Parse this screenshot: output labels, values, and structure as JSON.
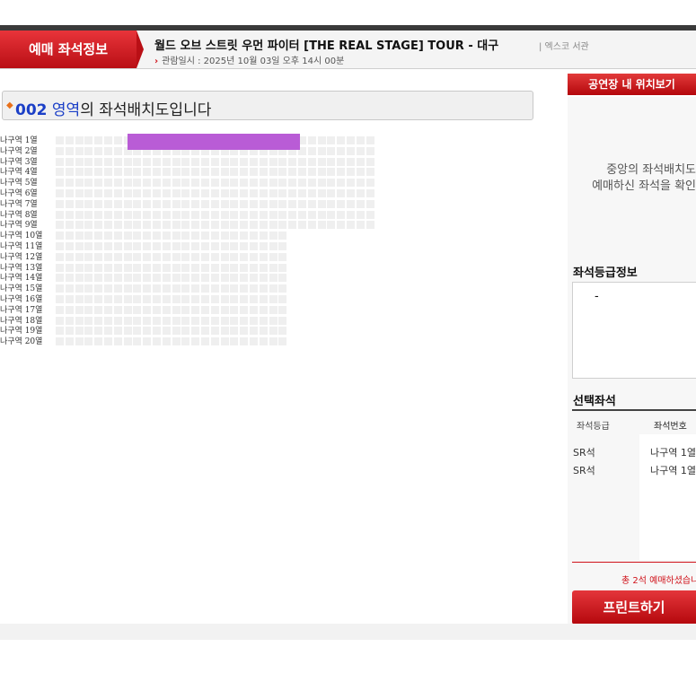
{
  "header": {
    "brand": "예매 좌석정보",
    "show_title": "월드 오브 스트릿 우먼 파이터 [THE REAL STAGE] TOUR - 대구",
    "venue": "| 엑스코 서관",
    "date_line": "관람일시 : 2025년 10월 03일 오후 14시 00분"
  },
  "location_button": "공연장 내 위치보기",
  "zone": {
    "number": "002",
    "name": "영역",
    "suffix": "의 좌석배치도입니다"
  },
  "rows": [
    "나구역 1열",
    "나구역 2열",
    "나구역 3열",
    "나구역 4열",
    "나구역 5열",
    "나구역 6열",
    "나구역 7열",
    "나구역 8열",
    "나구역 9열",
    "나구역 10열",
    "나구역 11열",
    "나구역 12열",
    "나구역 13열",
    "나구역 14열",
    "나구역 15열",
    "나구역 16열",
    "나구역 17열",
    "나구역 18열",
    "나구역 19열",
    "나구역 20열"
  ],
  "guide": {
    "line1": "중앙의 좌석배치도",
    "line2": "예매하신 좌석을 확인"
  },
  "grade_info": {
    "title": "좌석등급정보",
    "value": "-"
  },
  "selected": {
    "title": "선택좌석",
    "col_grade": "좌석등급",
    "col_number": "좌석번호",
    "items": [
      {
        "grade": "SR석",
        "seat": "나구역 1열"
      },
      {
        "grade": "SR석",
        "seat": "나구역 1열"
      }
    ],
    "total": "총 2석 예매하셨습니",
    "print_button": "프린트하기"
  },
  "colors": {
    "brand_red": "#c8141b",
    "selected_seat": "#b95cd6",
    "zone_blue": "#1b3fc7"
  }
}
